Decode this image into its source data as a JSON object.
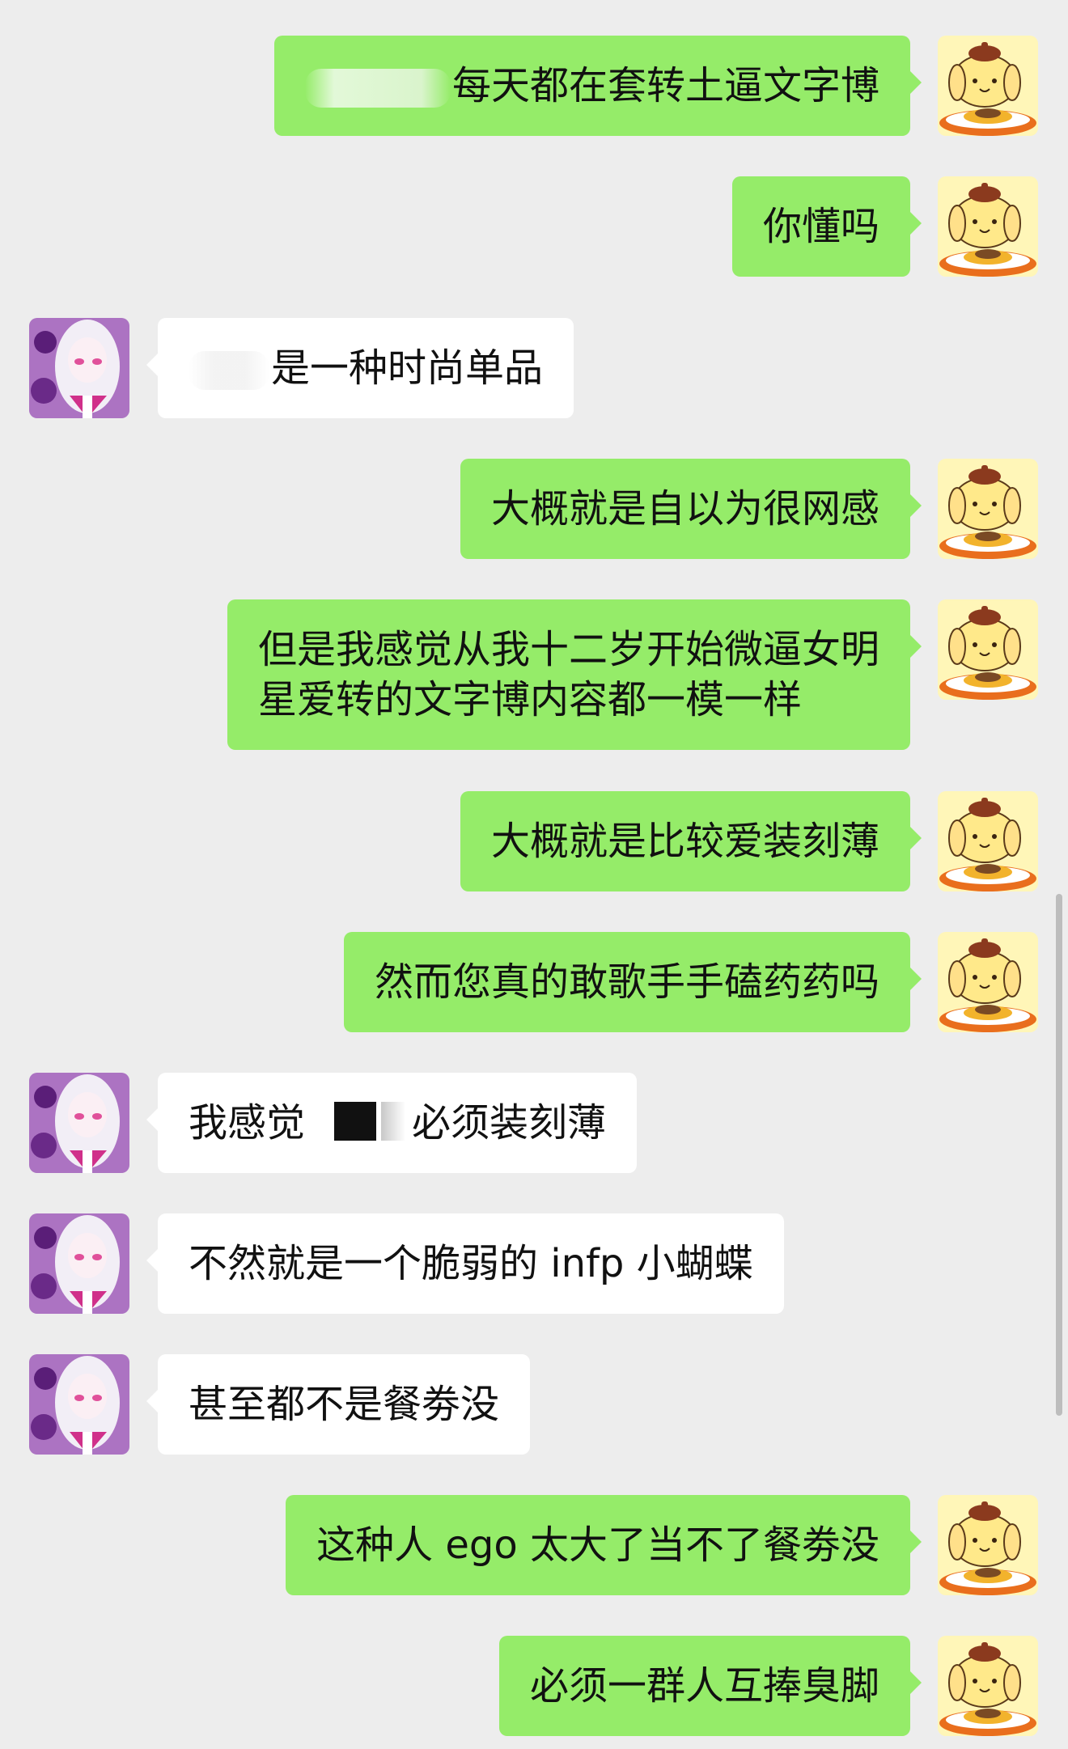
{
  "conversation": {
    "messages": [
      {
        "side": "right",
        "text": "每天都在套转土逼文字博",
        "redacted_prefix": true
      },
      {
        "side": "right",
        "text": "你懂吗"
      },
      {
        "side": "left",
        "text": "是一种时尚单品",
        "redacted_prefix": true
      },
      {
        "side": "right",
        "text": "大概就是自以为很网感"
      },
      {
        "side": "right",
        "line1": "但是我感觉从我十二岁开始微逼女明",
        "line2": "星爱转的文字博内容都一模一样"
      },
      {
        "side": "right",
        "text": "大概就是比较爱装刻薄"
      },
      {
        "side": "right",
        "text": "然而您真的敢歌手手磕药药吗"
      },
      {
        "side": "left",
        "before": "我感觉",
        "after": "必须装刻薄",
        "redacted_middle": true
      },
      {
        "side": "left",
        "text": "不然就是一个脆弱的 infp 小蝴蝶"
      },
      {
        "side": "left",
        "text": "甚至都不是餐劵没"
      },
      {
        "side": "right",
        "text": "这种人 ego 太大了当不了餐劵没"
      },
      {
        "side": "right",
        "text": "必须一群人互捧臭脚"
      }
    ]
  },
  "avatars": {
    "self": {
      "icon": "pompompurin-avatar-icon"
    },
    "other": {
      "icon": "anime-girl-avatar-icon"
    }
  },
  "colors": {
    "background": "#ededed",
    "sent_bubble": "#95ec69",
    "received_bubble": "#ffffff",
    "text": "#111111"
  }
}
